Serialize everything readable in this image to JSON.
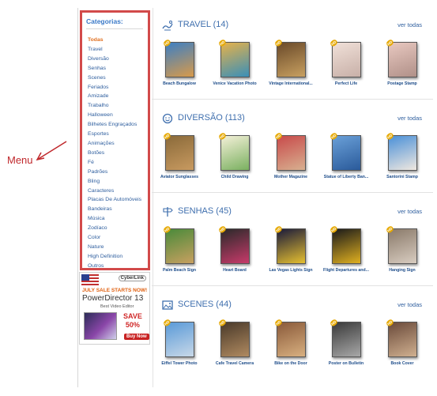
{
  "annotation": {
    "label": "Menu"
  },
  "menu": {
    "title": "Categorias:",
    "items": [
      {
        "label": "Todas",
        "active": true
      },
      {
        "label": "Travel"
      },
      {
        "label": "Diversão"
      },
      {
        "label": "Senhas"
      },
      {
        "label": "Scenes"
      },
      {
        "label": "Feriados"
      },
      {
        "label": "Amizade"
      },
      {
        "label": "Trabalho"
      },
      {
        "label": "Halloween"
      },
      {
        "label": "Bilhetes Engraçados"
      },
      {
        "label": "Esportes"
      },
      {
        "label": "Animações"
      },
      {
        "label": "Botões"
      },
      {
        "label": "Fé"
      },
      {
        "label": "Padrões"
      },
      {
        "label": "Bling"
      },
      {
        "label": "Caracteres"
      },
      {
        "label": "Placas De Automóveis"
      },
      {
        "label": "Bandeiras"
      },
      {
        "label": "Música"
      },
      {
        "label": "Zodíaco"
      },
      {
        "label": "Color"
      },
      {
        "label": "Nature"
      },
      {
        "label": "High Definition"
      },
      {
        "label": "Outros"
      }
    ]
  },
  "ad": {
    "brand": "CyberLink",
    "promo": "JULY SALE STARTS NOW!",
    "product": "PowerDirector 13",
    "tagline": "Best Video Editor",
    "save": "SAVE",
    "percent": "50%",
    "cta": "Buy Now"
  },
  "sections": [
    {
      "icon": "travel-icon",
      "title": "TRAVEL (14)",
      "more": "ver todas",
      "items": [
        {
          "caption": "Beach Bungalow",
          "colors": [
            "#3c7fc4",
            "#d89a4a"
          ]
        },
        {
          "caption": "Venice Vacation Photo",
          "colors": [
            "#e6b24a",
            "#3a8fb8"
          ]
        },
        {
          "caption": "Vintage International...",
          "colors": [
            "#6a4a2a",
            "#c8a060"
          ]
        },
        {
          "caption": "Perfect Life",
          "colors": [
            "#f0e0d8",
            "#c8b0a8"
          ]
        },
        {
          "caption": "Postage Stamp",
          "colors": [
            "#e8c8c0",
            "#b09088"
          ]
        }
      ]
    },
    {
      "icon": "smiley-icon",
      "title": "DIVERSÃO (113)",
      "more": "ver todas",
      "items": [
        {
          "caption": "Aviator Sunglasses",
          "colors": [
            "#8a6a3a",
            "#c89a60"
          ]
        },
        {
          "caption": "Child Drawing",
          "colors": [
            "#f4f0d8",
            "#7ab060"
          ]
        },
        {
          "caption": "Mother Magazine",
          "colors": [
            "#c84a4a",
            "#d8b090"
          ]
        },
        {
          "caption": "Statue of Liberty Ban...",
          "colors": [
            "#6aa0d8",
            "#2a5a9a"
          ]
        },
        {
          "caption": "Santorini Stamp",
          "colors": [
            "#4a90d8",
            "#f0e8e0"
          ]
        }
      ]
    },
    {
      "icon": "signpost-icon",
      "title": "SENHAS (45)",
      "more": "ver todas",
      "items": [
        {
          "caption": "Palm Beach Sign",
          "colors": [
            "#4a8a3a",
            "#c8a060"
          ]
        },
        {
          "caption": "Heart Board",
          "colors": [
            "#2a2a2a",
            "#c83a6a"
          ]
        },
        {
          "caption": "Las Vegas Lights Sign",
          "colors": [
            "#1a1a3a",
            "#e6c030"
          ]
        },
        {
          "caption": "Flight Departures and...",
          "colors": [
            "#1a1a1a",
            "#e0b020"
          ]
        },
        {
          "caption": "Hanging Sign",
          "colors": [
            "#8a7a6a",
            "#d8ccc0"
          ]
        }
      ]
    },
    {
      "icon": "picture-icon",
      "title": "SCENES (44)",
      "more": "ver todas",
      "items": [
        {
          "caption": "Eiffel Tower Photo",
          "colors": [
            "#5a9ad8",
            "#c8d8e8"
          ]
        },
        {
          "caption": "Cafe Travel Camera",
          "colors": [
            "#4a3a2a",
            "#b08a60"
          ]
        },
        {
          "caption": "Bike on the Door",
          "colors": [
            "#8a5a3a",
            "#d8b080"
          ]
        },
        {
          "caption": "Poster on Bulletin",
          "colors": [
            "#3a3a3a",
            "#a8a8a8"
          ]
        },
        {
          "caption": "Book Cover",
          "colors": [
            "#6a4a3a",
            "#d0b090"
          ]
        }
      ]
    }
  ]
}
